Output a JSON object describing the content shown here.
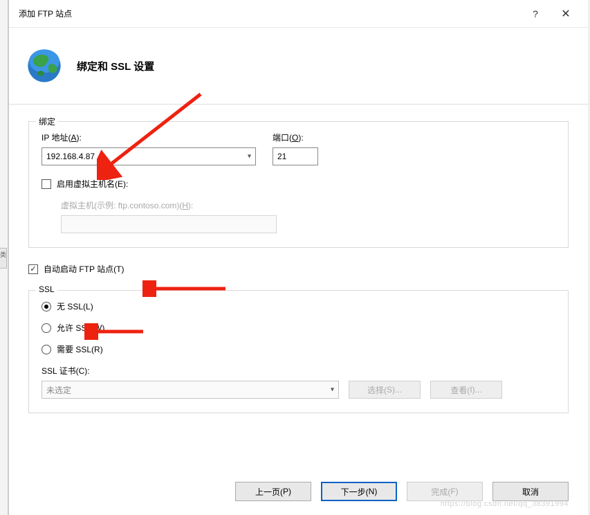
{
  "window": {
    "title": "添加 FTP 站点",
    "help": "?",
    "close": "✕"
  },
  "header": {
    "title": "绑定和 SSL 设置"
  },
  "binding": {
    "legend": "绑定",
    "ip_label_pre": "IP 地址(",
    "ip_label_u": "A",
    "ip_label_post": "):",
    "ip_value": "192.168.4.87",
    "port_label_pre": "端口(",
    "port_label_u": "O",
    "port_label_post": "):",
    "port_value": "21",
    "vhost_chk_pre": "启用虚拟主机名(",
    "vhost_chk_u": "E",
    "vhost_chk_post": "):",
    "vhost_label_pre": "虚拟主机(示例: ftp.contoso.com)(",
    "vhost_label_u": "H",
    "vhost_label_post": "):"
  },
  "auto_start": {
    "label_pre": "自动启动 FTP 站点(",
    "label_u": "T",
    "label_post": ")"
  },
  "ssl": {
    "legend": "SSL",
    "none_pre": "无 SSL(",
    "none_u": "L",
    "none_post": ")",
    "allow_pre": "允许 SSL(",
    "allow_u": "W",
    "allow_post": ")",
    "require_pre": "需要 SSL(",
    "require_u": "R",
    "require_post": ")",
    "cert_label_pre": "SSL 证书(",
    "cert_label_u": "C",
    "cert_label_post": "):",
    "cert_value": "未选定",
    "select_btn_pre": "选择(",
    "select_btn_u": "S",
    "select_btn_post": ")...",
    "view_btn_pre": "查看(",
    "view_btn_u": "I",
    "view_btn_post": ")..."
  },
  "footer": {
    "prev_pre": "上一页(",
    "prev_u": "P",
    "prev_post": ")",
    "next_pre": "下一步(",
    "next_u": "N",
    "next_post": ")",
    "finish_pre": "完成(",
    "finish_u": "F",
    "finish_post": ")",
    "cancel": "取消"
  },
  "watermark": "https://blog.csdn.net/qq_38391994"
}
